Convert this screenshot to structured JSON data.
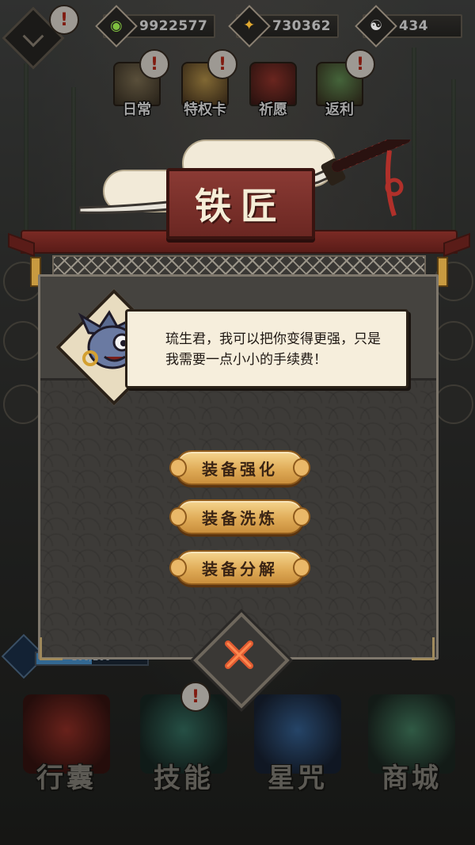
{
  "currencies": [
    {
      "icon": "jade-icon",
      "value": "9922577",
      "color": "#7fbf3f"
    },
    {
      "icon": "gold-coin-icon",
      "value": "730362",
      "color": "#e0a830"
    },
    {
      "icon": "yinyang-icon",
      "value": "434",
      "color": "#d8d8d8"
    }
  ],
  "events": [
    {
      "label": "日常",
      "icon": "scroll-icon"
    },
    {
      "label": "特权卡",
      "icon": "card-icon"
    },
    {
      "label": "祈愿",
      "icon": "shrine-icon"
    },
    {
      "label": "返利",
      "icon": "treasure-icon"
    }
  ],
  "dialog": {
    "title": "铁匠",
    "speech": "琉生君，我可以把你变得更强，只是我需要一点小小的手续费！",
    "buttons": [
      {
        "label": "装备强化"
      },
      {
        "label": "装备洗炼"
      },
      {
        "label": "装备分解"
      }
    ]
  },
  "energy": {
    "text": "100/200",
    "fill": 0.5
  },
  "nav": [
    {
      "label": "行囊",
      "icon": "pouch-icon"
    },
    {
      "label": "技能",
      "icon": "weapon-icon"
    },
    {
      "label": "星咒",
      "icon": "star-scroll-icon"
    },
    {
      "label": "商城",
      "icon": "shop-icon"
    }
  ],
  "alert_glyph": "!",
  "colors": {
    "accent": "#e0ac58",
    "title_wood": "#7a2f2a",
    "close_red": "#e05a30"
  }
}
